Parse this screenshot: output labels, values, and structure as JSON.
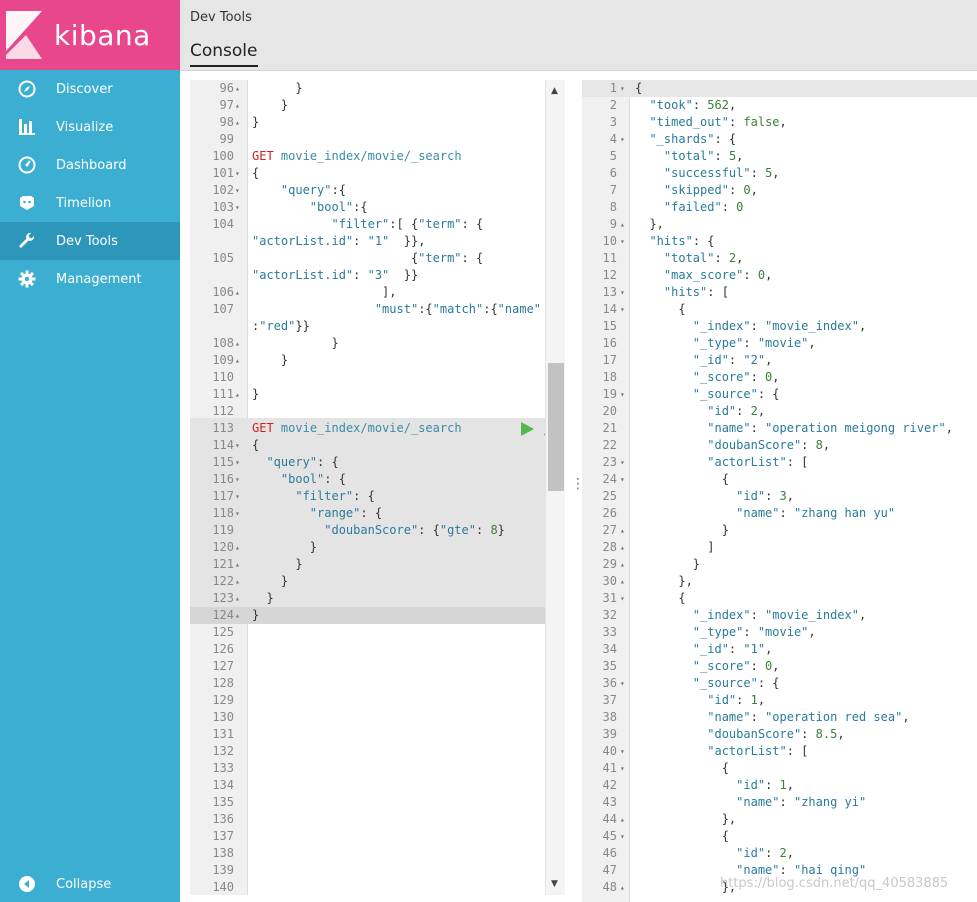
{
  "app": {
    "brand": "kibana",
    "section": "Dev Tools",
    "tab": "Console"
  },
  "sidebar": {
    "items": [
      {
        "label": "Discover",
        "icon": "compass-icon"
      },
      {
        "label": "Visualize",
        "icon": "bar-chart-icon"
      },
      {
        "label": "Dashboard",
        "icon": "gauge-icon"
      },
      {
        "label": "Timelion",
        "icon": "timelion-icon"
      },
      {
        "label": "Dev Tools",
        "icon": "wrench-icon",
        "active": true
      },
      {
        "label": "Management",
        "icon": "gear-icon"
      }
    ],
    "collapse_label": "Collapse"
  },
  "editor": {
    "lines": [
      {
        "n": "96",
        "f": "▴",
        "c": "      }"
      },
      {
        "n": "97",
        "f": "▴",
        "c": "    }"
      },
      {
        "n": "98",
        "f": "▴",
        "c": "}"
      },
      {
        "n": "99",
        "f": "",
        "c": ""
      },
      {
        "n": "100",
        "f": "",
        "c": "GET movie_index/movie/_search"
      },
      {
        "n": "101",
        "f": "▾",
        "c": "{"
      },
      {
        "n": "102",
        "f": "▾",
        "c": "    \"query\":{"
      },
      {
        "n": "103",
        "f": "▾",
        "c": "        \"bool\":{"
      },
      {
        "n": "104",
        "f": "",
        "c": "           \"filter\":[ {\"term\": {"
      },
      {
        "n": "",
        "f": "",
        "c": "\"actorList.id\": \"1\"  }},"
      },
      {
        "n": "105",
        "f": "",
        "c": "                      {\"term\": {"
      },
      {
        "n": "",
        "f": "",
        "c": "\"actorList.id\": \"3\"  }}"
      },
      {
        "n": "106",
        "f": "▴",
        "c": "                  ],"
      },
      {
        "n": "107",
        "f": "",
        "c": "                 \"must\":{\"match\":{\"name\""
      },
      {
        "n": "",
        "f": "",
        "c": ":\"red\"}}"
      },
      {
        "n": "108",
        "f": "▴",
        "c": "           }"
      },
      {
        "n": "109",
        "f": "▴",
        "c": "    }"
      },
      {
        "n": "110",
        "f": "",
        "c": ""
      },
      {
        "n": "111",
        "f": "▴",
        "c": "}"
      },
      {
        "n": "112",
        "f": "",
        "c": ""
      },
      {
        "n": "113",
        "f": "",
        "c": "GET movie_index/movie/_search"
      },
      {
        "n": "114",
        "f": "▾",
        "c": "{"
      },
      {
        "n": "115",
        "f": "▾",
        "c": "  \"query\": {"
      },
      {
        "n": "116",
        "f": "▾",
        "c": "    \"bool\": {"
      },
      {
        "n": "117",
        "f": "▾",
        "c": "      \"filter\": {"
      },
      {
        "n": "118",
        "f": "▾",
        "c": "        \"range\": {"
      },
      {
        "n": "119",
        "f": "",
        "c": "          \"doubanScore\": {\"gte\": 8}"
      },
      {
        "n": "120",
        "f": "▴",
        "c": "        }"
      },
      {
        "n": "121",
        "f": "▴",
        "c": "      }"
      },
      {
        "n": "122",
        "f": "▴",
        "c": "    }"
      },
      {
        "n": "123",
        "f": "▴",
        "c": "  }"
      },
      {
        "n": "124",
        "f": "▴",
        "c": "}"
      },
      {
        "n": "125",
        "f": "",
        "c": ""
      },
      {
        "n": "126",
        "f": "",
        "c": ""
      },
      {
        "n": "127",
        "f": "",
        "c": ""
      },
      {
        "n": "128",
        "f": "",
        "c": ""
      },
      {
        "n": "129",
        "f": "",
        "c": ""
      },
      {
        "n": "130",
        "f": "",
        "c": ""
      },
      {
        "n": "131",
        "f": "",
        "c": ""
      },
      {
        "n": "132",
        "f": "",
        "c": ""
      },
      {
        "n": "133",
        "f": "",
        "c": ""
      },
      {
        "n": "134",
        "f": "",
        "c": ""
      },
      {
        "n": "135",
        "f": "",
        "c": ""
      },
      {
        "n": "136",
        "f": "",
        "c": ""
      },
      {
        "n": "137",
        "f": "",
        "c": ""
      },
      {
        "n": "138",
        "f": "",
        "c": ""
      },
      {
        "n": "139",
        "f": "",
        "c": ""
      },
      {
        "n": "140",
        "f": "",
        "c": ""
      }
    ]
  },
  "output": {
    "lines": [
      {
        "n": "1",
        "f": "▾",
        "c": "{"
      },
      {
        "n": "2",
        "f": "",
        "c": "  \"took\": 562,"
      },
      {
        "n": "3",
        "f": "",
        "c": "  \"timed_out\": false,"
      },
      {
        "n": "4",
        "f": "▾",
        "c": "  \"_shards\": {"
      },
      {
        "n": "5",
        "f": "",
        "c": "    \"total\": 5,"
      },
      {
        "n": "6",
        "f": "",
        "c": "    \"successful\": 5,"
      },
      {
        "n": "7",
        "f": "",
        "c": "    \"skipped\": 0,"
      },
      {
        "n": "8",
        "f": "",
        "c": "    \"failed\": 0"
      },
      {
        "n": "9",
        "f": "▴",
        "c": "  },"
      },
      {
        "n": "10",
        "f": "▾",
        "c": "  \"hits\": {"
      },
      {
        "n": "11",
        "f": "",
        "c": "    \"total\": 2,"
      },
      {
        "n": "12",
        "f": "",
        "c": "    \"max_score\": 0,"
      },
      {
        "n": "13",
        "f": "▾",
        "c": "    \"hits\": ["
      },
      {
        "n": "14",
        "f": "▾",
        "c": "      {"
      },
      {
        "n": "15",
        "f": "",
        "c": "        \"_index\": \"movie_index\","
      },
      {
        "n": "16",
        "f": "",
        "c": "        \"_type\": \"movie\","
      },
      {
        "n": "17",
        "f": "",
        "c": "        \"_id\": \"2\","
      },
      {
        "n": "18",
        "f": "",
        "c": "        \"_score\": 0,"
      },
      {
        "n": "19",
        "f": "▾",
        "c": "        \"_source\": {"
      },
      {
        "n": "20",
        "f": "",
        "c": "          \"id\": 2,"
      },
      {
        "n": "21",
        "f": "",
        "c": "          \"name\": \"operation meigong river\","
      },
      {
        "n": "22",
        "f": "",
        "c": "          \"doubanScore\": 8,"
      },
      {
        "n": "23",
        "f": "▾",
        "c": "          \"actorList\": ["
      },
      {
        "n": "24",
        "f": "▾",
        "c": "            {"
      },
      {
        "n": "25",
        "f": "",
        "c": "              \"id\": 3,"
      },
      {
        "n": "26",
        "f": "",
        "c": "              \"name\": \"zhang han yu\""
      },
      {
        "n": "27",
        "f": "▴",
        "c": "            }"
      },
      {
        "n": "28",
        "f": "▴",
        "c": "          ]"
      },
      {
        "n": "29",
        "f": "▴",
        "c": "        }"
      },
      {
        "n": "30",
        "f": "▴",
        "c": "      },"
      },
      {
        "n": "31",
        "f": "▾",
        "c": "      {"
      },
      {
        "n": "32",
        "f": "",
        "c": "        \"_index\": \"movie_index\","
      },
      {
        "n": "33",
        "f": "",
        "c": "        \"_type\": \"movie\","
      },
      {
        "n": "34",
        "f": "",
        "c": "        \"_id\": \"1\","
      },
      {
        "n": "35",
        "f": "",
        "c": "        \"_score\": 0,"
      },
      {
        "n": "36",
        "f": "▾",
        "c": "        \"_source\": {"
      },
      {
        "n": "37",
        "f": "",
        "c": "          \"id\": 1,"
      },
      {
        "n": "38",
        "f": "",
        "c": "          \"name\": \"operation red sea\","
      },
      {
        "n": "39",
        "f": "",
        "c": "          \"doubanScore\": 8.5,"
      },
      {
        "n": "40",
        "f": "▾",
        "c": "          \"actorList\": ["
      },
      {
        "n": "41",
        "f": "▾",
        "c": "            {"
      },
      {
        "n": "42",
        "f": "",
        "c": "              \"id\": 1,"
      },
      {
        "n": "43",
        "f": "",
        "c": "              \"name\": \"zhang yi\""
      },
      {
        "n": "44",
        "f": "▴",
        "c": "            },"
      },
      {
        "n": "45",
        "f": "▾",
        "c": "            {"
      },
      {
        "n": "46",
        "f": "",
        "c": "              \"id\": 2,"
      },
      {
        "n": "47",
        "f": "",
        "c": "              \"name\": \"hai qing\""
      },
      {
        "n": "48",
        "f": "▴",
        "c": "            },"
      }
    ]
  },
  "watermark": "https://blog.csdn.net/qq_40583885",
  "colors": {
    "sidebar": "#3caed2",
    "logo_bg": "#e8488b",
    "active_item": "#2d97bb",
    "method": "#cc2222",
    "url": "#3b8ba8",
    "run": "#54b94b"
  }
}
